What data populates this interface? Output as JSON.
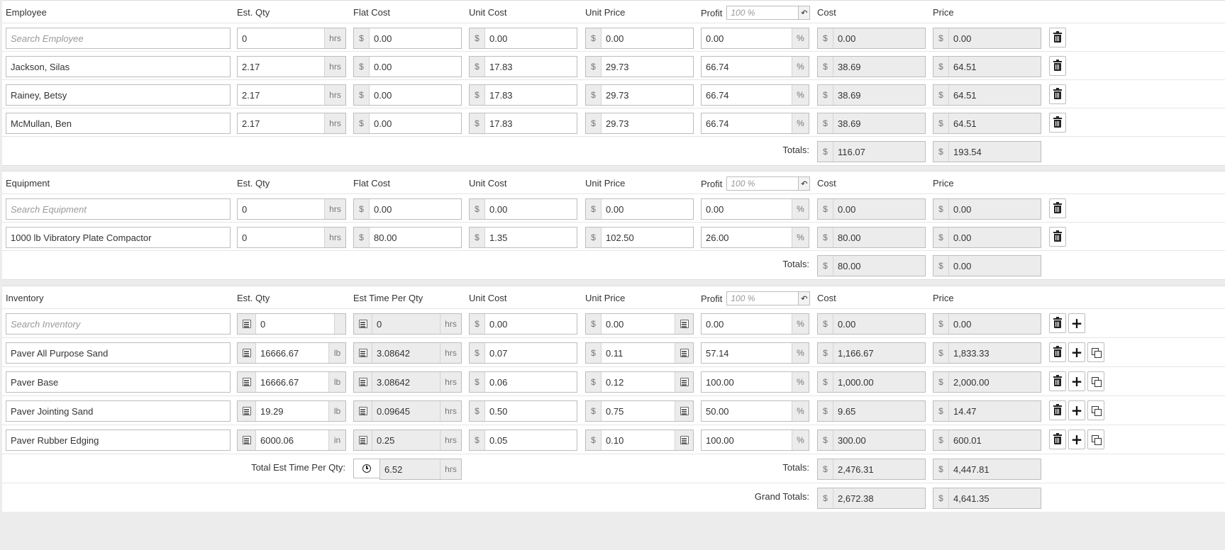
{
  "employee": {
    "header": {
      "name": "Employee",
      "qty": "Est. Qty",
      "flat": "Flat Cost",
      "unit_cost": "Unit Cost",
      "unit_price": "Unit Price",
      "profit": "Profit",
      "profit_ph": "100 %",
      "cost": "Cost",
      "price": "Price"
    },
    "search": {
      "placeholder": "Search Employee",
      "qty": "0",
      "unit": "hrs",
      "flat": "0.00",
      "unit_cost": "0.00",
      "unit_price": "0.00",
      "profit": "0.00",
      "cost": "0.00",
      "price": "0.00"
    },
    "rows": [
      {
        "name": "Jackson, Silas",
        "qty": "2.17",
        "unit": "hrs",
        "flat": "0.00",
        "unit_cost": "17.83",
        "unit_price": "29.73",
        "profit": "66.74",
        "cost": "38.69",
        "price": "64.51"
      },
      {
        "name": "Rainey, Betsy",
        "qty": "2.17",
        "unit": "hrs",
        "flat": "0.00",
        "unit_cost": "17.83",
        "unit_price": "29.73",
        "profit": "66.74",
        "cost": "38.69",
        "price": "64.51"
      },
      {
        "name": "McMullan, Ben",
        "qty": "2.17",
        "unit": "hrs",
        "flat": "0.00",
        "unit_cost": "17.83",
        "unit_price": "29.73",
        "profit": "66.74",
        "cost": "38.69",
        "price": "64.51"
      }
    ],
    "totals": {
      "label": "Totals:",
      "cost": "116.07",
      "price": "193.54"
    }
  },
  "equipment": {
    "header": {
      "name": "Equipment",
      "qty": "Est. Qty",
      "flat": "Flat Cost",
      "unit_cost": "Unit Cost",
      "unit_price": "Unit Price",
      "profit": "Profit",
      "profit_ph": "100 %",
      "cost": "Cost",
      "price": "Price"
    },
    "search": {
      "placeholder": "Search Equipment",
      "qty": "0",
      "unit": "hrs",
      "flat": "0.00",
      "unit_cost": "0.00",
      "unit_price": "0.00",
      "profit": "0.00",
      "cost": "0.00",
      "price": "0.00"
    },
    "rows": [
      {
        "name": "1000 lb Vibratory Plate Compactor",
        "qty": "0",
        "unit": "hrs",
        "flat": "80.00",
        "unit_cost": "1.35",
        "unit_price": "102.50",
        "profit": "26.00",
        "cost": "80.00",
        "price": "0.00"
      }
    ],
    "totals": {
      "label": "Totals:",
      "cost": "80.00",
      "price": "0.00"
    }
  },
  "inventory": {
    "header": {
      "name": "Inventory",
      "qty": "Est. Qty",
      "time": "Est Time Per Qty",
      "unit_cost": "Unit Cost",
      "unit_price": "Unit Price",
      "profit": "Profit",
      "profit_ph": "100 %",
      "cost": "Cost",
      "price": "Price"
    },
    "search": {
      "placeholder": "Search Inventory",
      "qty": "0",
      "unit": "",
      "time": "0",
      "time_unit": "hrs",
      "unit_cost": "0.00",
      "unit_price": "0.00",
      "profit": "0.00",
      "cost": "0.00",
      "price": "0.00"
    },
    "rows": [
      {
        "name": "Paver All Purpose Sand",
        "qty": "16666.67",
        "unit": "lb",
        "time": "3.08642",
        "time_unit": "hrs",
        "unit_cost": "0.07",
        "unit_price": "0.11",
        "profit": "57.14",
        "cost": "1,166.67",
        "price": "1,833.33"
      },
      {
        "name": "Paver Base",
        "qty": "16666.67",
        "unit": "lb",
        "time": "3.08642",
        "time_unit": "hrs",
        "unit_cost": "0.06",
        "unit_price": "0.12",
        "profit": "100.00",
        "cost": "1,000.00",
        "price": "2,000.00"
      },
      {
        "name": "Paver Jointing Sand",
        "qty": "19.29",
        "unit": "lb",
        "time": "0.09645",
        "time_unit": "hrs",
        "unit_cost": "0.50",
        "unit_price": "0.75",
        "profit": "50.00",
        "cost": "9.65",
        "price": "14.47"
      },
      {
        "name": "Paver Rubber Edging",
        "qty": "6000.06",
        "unit": "in",
        "time": "0.25",
        "time_unit": "hrs",
        "unit_cost": "0.05",
        "unit_price": "0.10",
        "profit": "100.00",
        "cost": "300.00",
        "price": "600.01"
      }
    ],
    "time_total": {
      "label": "Total Est Time Per Qty:",
      "value": "6.52",
      "unit": "hrs"
    },
    "totals": {
      "label": "Totals:",
      "cost": "2,476.31",
      "price": "4,447.81"
    }
  },
  "grand": {
    "label": "Grand Totals:",
    "cost": "2,672.38",
    "price": "4,641.35"
  },
  "symbols": {
    "currency": "$",
    "percent": "%",
    "undo": "↶",
    "plus": "+"
  }
}
